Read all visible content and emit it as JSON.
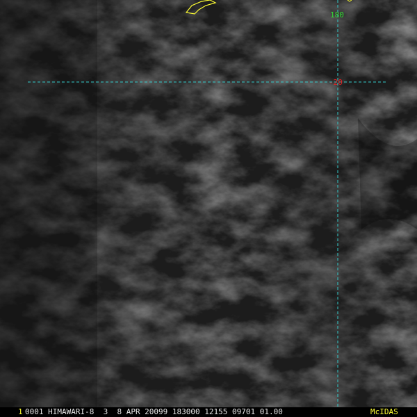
{
  "image": {
    "colors": {
      "background": "#1c1c1c",
      "cloud": "#5a5a5a",
      "gridline": "#33cccc",
      "lon_label": "#33dd33",
      "lat_label": "#dd2222",
      "coast": "#ffff33",
      "frame_label": "#ffff33",
      "status_text": "#e6e6e6"
    }
  },
  "graticule": {
    "longitude_label": "180",
    "latitude_label": "-20"
  },
  "status_bar": {
    "frame_number": "1",
    "info": "0001 HIMAWARI-8  3  8 APR 20099 183000 12155 09701 01.00",
    "software": "McIDAS"
  }
}
